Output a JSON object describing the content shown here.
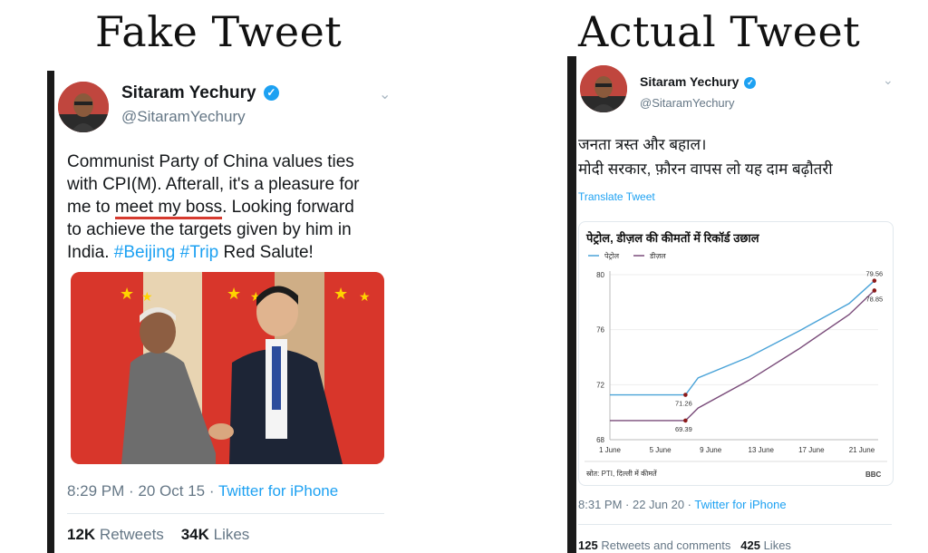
{
  "headings": {
    "fake": "Fake Tweet",
    "actual": "Actual Tweet"
  },
  "fake": {
    "author": "Sitaram Yechury",
    "handle": "@SitaramYechury",
    "text": {
      "l1": "Communist Party of China values ties",
      "l2": "with CPI(M). Afterall, it's a pleasure for",
      "l3a": "me to ",
      "l3b": "meet my boss",
      "l3c": ". Looking forward",
      "l4": "to achieve the targets given by him in",
      "l5a": "India. ",
      "tag1": "#Beijing",
      "tag2": "#Trip",
      "l5b": " Red Salute!"
    },
    "time": "8:29 PM · 20 Oct 15 · ",
    "source": "Twitter for iPhone",
    "retweets_count": "12K",
    "retweets_label": "Retweets",
    "likes_count": "34K",
    "likes_label": "Likes"
  },
  "actual": {
    "author": "Sitaram Yechury",
    "handle": "@SitaramYechury",
    "text_l1": "जनता त्रस्त और बहाल।",
    "text_l2": "मोदी सरकार, फ़ौरन वापस लो यह दाम बढ़ौतरी",
    "translate": "Translate Tweet",
    "time": "8:31 PM · 22 Jun 20 · ",
    "source": "Twitter for iPhone",
    "retweets_count": "125",
    "retweets_label": "Retweets and comments",
    "likes_count": "425",
    "likes_label": "Likes",
    "card_source": "स्रोत: PTI, दिल्ली में कीमतें",
    "card_logo": "BBC"
  },
  "chart_data": {
    "type": "line",
    "title": "पेट्रोल, डीज़ल की कीमतों में रिकॉर्ड उछाल",
    "x_ticks": [
      "1 June",
      "5 June",
      "9 June",
      "13 June",
      "17 June",
      "21 June"
    ],
    "y_ticks": [
      "80",
      "76",
      "72",
      "68"
    ],
    "ylim": [
      68,
      80
    ],
    "series": [
      {
        "name": "पेट्रोल",
        "color": "#4aa3d8",
        "points": [
          [
            1,
            71.26
          ],
          [
            7,
            71.26
          ],
          [
            8,
            72.5
          ],
          [
            12,
            74.0
          ],
          [
            16,
            75.9
          ],
          [
            20,
            77.9
          ],
          [
            22,
            79.56
          ]
        ]
      },
      {
        "name": "डीज़ल",
        "color": "#7a4c7a",
        "points": [
          [
            1,
            69.39
          ],
          [
            7,
            69.39
          ],
          [
            8,
            70.3
          ],
          [
            12,
            72.3
          ],
          [
            16,
            74.6
          ],
          [
            20,
            77.1
          ],
          [
            22,
            78.85
          ]
        ]
      }
    ],
    "annotations": [
      {
        "text": "71.26",
        "x": 7,
        "y": 71.26
      },
      {
        "text": "69.39",
        "x": 7,
        "y": 69.39
      },
      {
        "text": "79.56",
        "x": 22,
        "y": 79.56
      },
      {
        "text": "78.85",
        "x": 22,
        "y": 78.85
      }
    ]
  }
}
